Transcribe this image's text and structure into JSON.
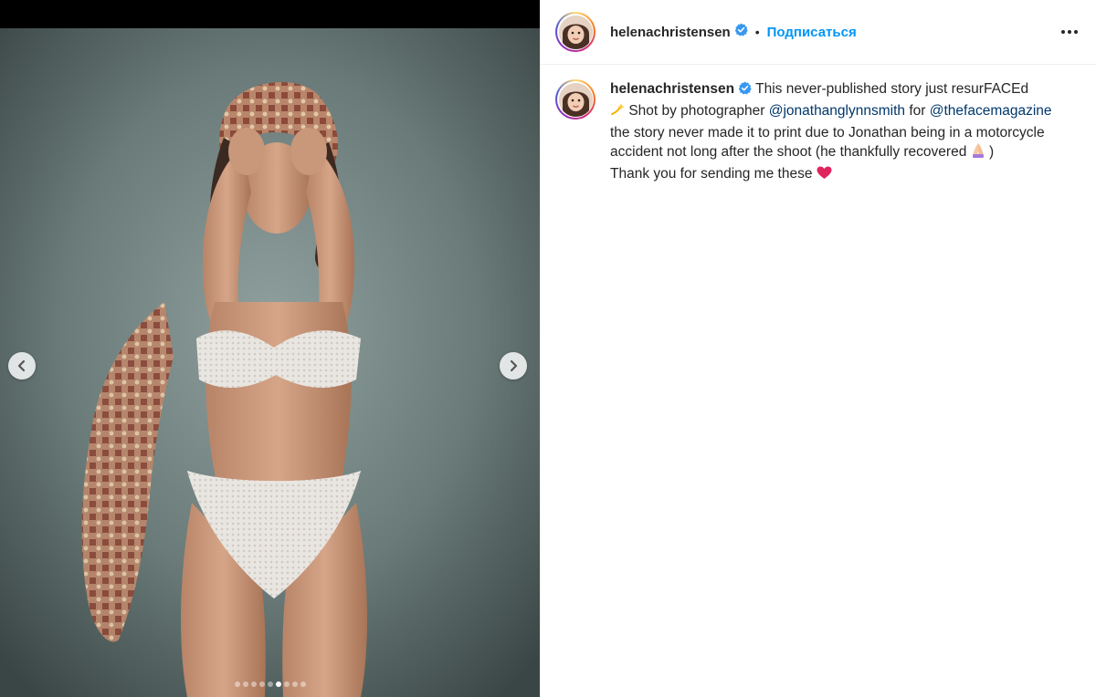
{
  "post": {
    "username": "helenachristensen",
    "follow_label": "Подписаться",
    "separator": "•",
    "more_label": "•••"
  },
  "caption": {
    "username": "helenachristensen",
    "line1_text": "This never-published story just resurFACEd",
    "line2_text": "Shot by photographer",
    "mention1": "@jonathanglynnsmith",
    "line2_tail": "for",
    "mention2": "@thefacemagazine",
    "line3_text": "the story never made it to print due to Jonathan being in a motorcycle accident not long after the shoot (he thankfully recovered",
    "line3_close": ")",
    "line4_text": "Thank you for sending me these"
  },
  "carousel": {
    "total_slides": 9,
    "active_index": 5
  },
  "colors": {
    "link": "#0095f6",
    "mention": "#00376b",
    "text": "#262626",
    "verified": "#3897f0",
    "heart": "#e0245e"
  },
  "icons": {
    "prev": "chevron-left-icon",
    "next": "chevron-right-icon",
    "verified": "verified-badge-icon",
    "more": "more-options-icon",
    "sparkle": "dizzy-sparkle-emoji",
    "pray": "folded-hands-emoji",
    "heart": "red-heart-emoji"
  }
}
